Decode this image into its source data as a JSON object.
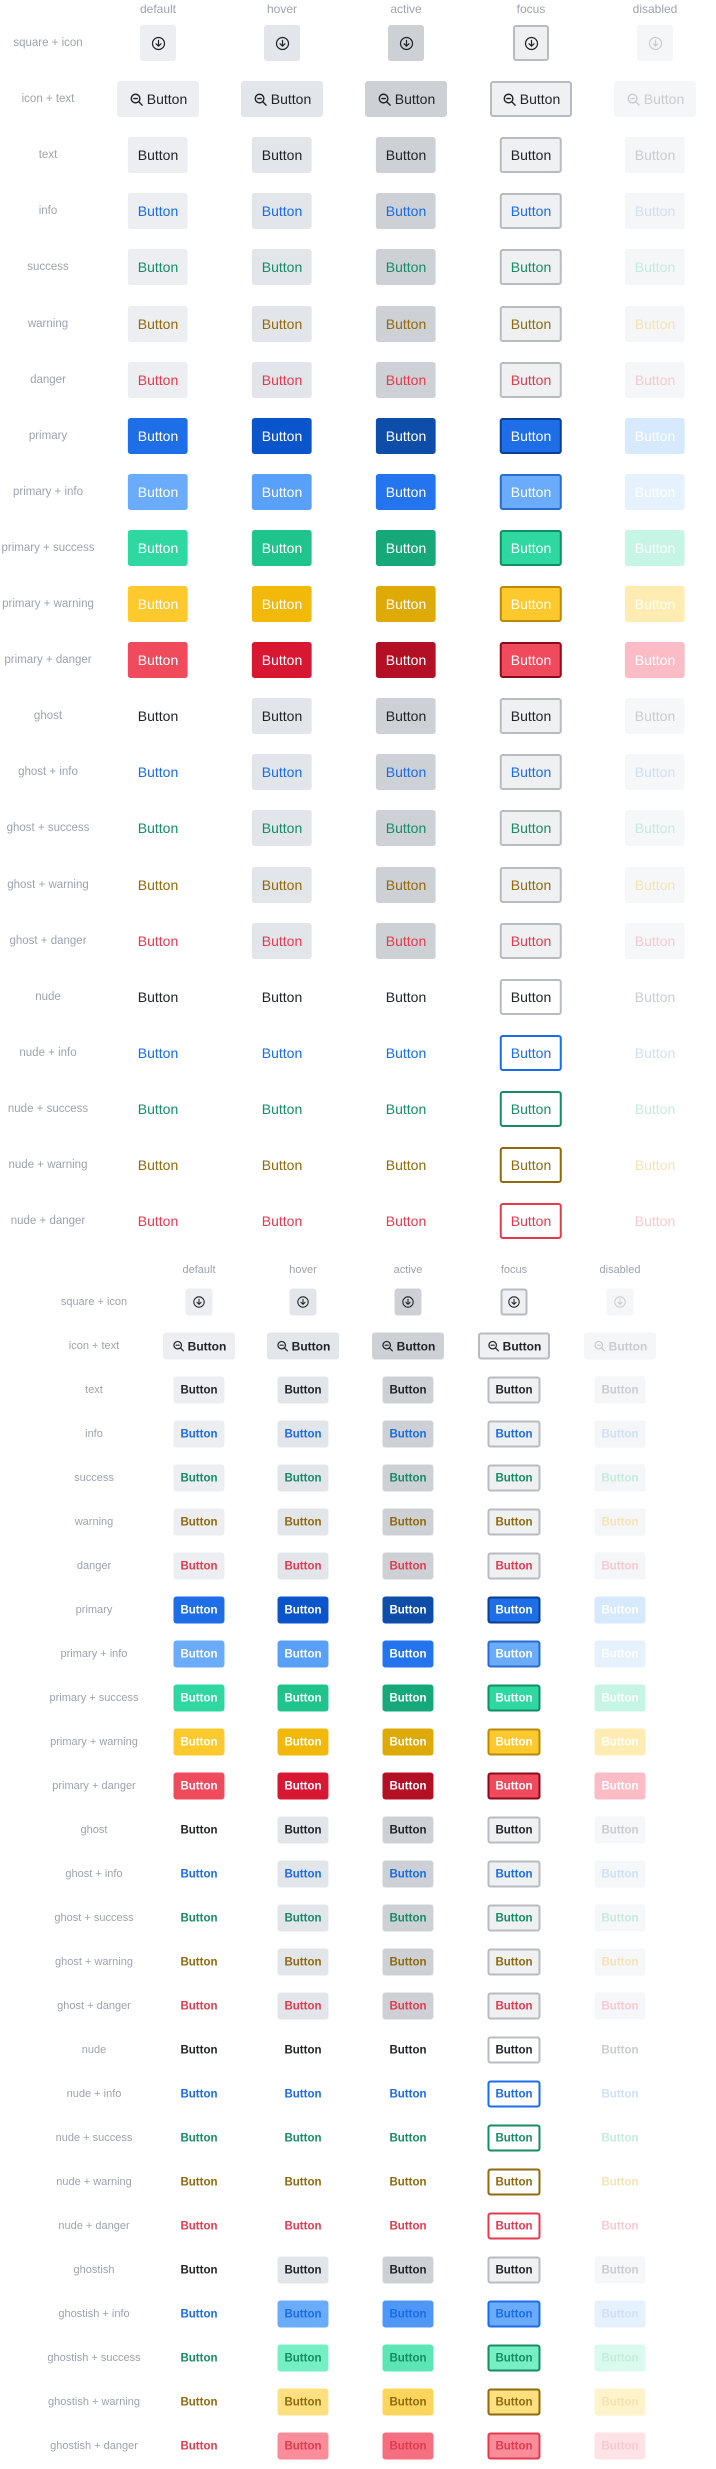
{
  "states": [
    "default",
    "hover",
    "active",
    "focus",
    "disabled"
  ],
  "button_text": "Button",
  "icons": {
    "square": "arrow-down-circle-icon",
    "text": "search-icon"
  },
  "colors": {
    "neutral_bg": "#eceef1",
    "neutral_hover": "#e2e5e9",
    "neutral_active": "#cdd0d4",
    "info": "#1a6ce8",
    "success": "#178c66",
    "warning": "#8f6a0e",
    "danger": "#e23b4f",
    "primary": "#1e6ee8",
    "primary_info": "#6aacfb",
    "primary_success": "#2ed8a0",
    "primary_warning": "#fdc92c",
    "primary_danger": "#f04a5d"
  },
  "grids": [
    {
      "size": "large",
      "rows": [
        {
          "label": "square + icon",
          "variant": "sq"
        },
        {
          "label": "icon + text",
          "variant": "it"
        },
        {
          "label": "text",
          "variant": "text"
        },
        {
          "label": "info",
          "variant": "info"
        },
        {
          "label": "success",
          "variant": "success"
        },
        {
          "label": "warning",
          "variant": "warning"
        },
        {
          "label": "danger",
          "variant": "danger"
        },
        {
          "label": "primary",
          "variant": "primary"
        },
        {
          "label": "primary + info",
          "variant": "primary_info"
        },
        {
          "label": "primary + success",
          "variant": "primary_success"
        },
        {
          "label": "primary + warning",
          "variant": "primary_warning"
        },
        {
          "label": "primary + danger",
          "variant": "primary_danger"
        },
        {
          "label": "ghost",
          "variant": "ghost"
        },
        {
          "label": "ghost + info",
          "variant": "ghost_info"
        },
        {
          "label": "ghost + success",
          "variant": "ghost_success"
        },
        {
          "label": "ghost + warning",
          "variant": "ghost_warning"
        },
        {
          "label": "ghost + danger",
          "variant": "ghost_danger"
        },
        {
          "label": "nude",
          "variant": "nude"
        },
        {
          "label": "nude + info",
          "variant": "nude_info"
        },
        {
          "label": "nude + success",
          "variant": "nude_success"
        },
        {
          "label": "nude + warning",
          "variant": "nude_warning"
        },
        {
          "label": "nude + danger",
          "variant": "nude_danger"
        }
      ]
    },
    {
      "size": "small",
      "rows": [
        {
          "label": "square + icon",
          "variant": "sq"
        },
        {
          "label": "icon + text",
          "variant": "it"
        },
        {
          "label": "text",
          "variant": "text"
        },
        {
          "label": "info",
          "variant": "info"
        },
        {
          "label": "success",
          "variant": "success"
        },
        {
          "label": "warning",
          "variant": "warning"
        },
        {
          "label": "danger",
          "variant": "danger"
        },
        {
          "label": "primary",
          "variant": "primary"
        },
        {
          "label": "primary + info",
          "variant": "primary_info"
        },
        {
          "label": "primary + success",
          "variant": "primary_success"
        },
        {
          "label": "primary + warning",
          "variant": "primary_warning"
        },
        {
          "label": "primary + danger",
          "variant": "primary_danger"
        },
        {
          "label": "ghost",
          "variant": "ghost"
        },
        {
          "label": "ghost + info",
          "variant": "ghost_info"
        },
        {
          "label": "ghost + success",
          "variant": "ghost_success"
        },
        {
          "label": "ghost + warning",
          "variant": "ghost_warning"
        },
        {
          "label": "ghost + danger",
          "variant": "ghost_danger"
        },
        {
          "label": "nude",
          "variant": "nude"
        },
        {
          "label": "nude + info",
          "variant": "nude_info"
        },
        {
          "label": "nude + success",
          "variant": "nude_success"
        },
        {
          "label": "nude + warning",
          "variant": "nude_warning"
        },
        {
          "label": "nude + danger",
          "variant": "nude_danger"
        },
        {
          "label": "ghostish",
          "variant": "ghostish"
        },
        {
          "label": "ghostish + info",
          "variant": "ghostish_info"
        },
        {
          "label": "ghostish + success",
          "variant": "ghostish_success"
        },
        {
          "label": "ghostish + warning",
          "variant": "ghostish_warning"
        },
        {
          "label": "ghostish + danger",
          "variant": "ghostish_danger"
        }
      ]
    }
  ]
}
